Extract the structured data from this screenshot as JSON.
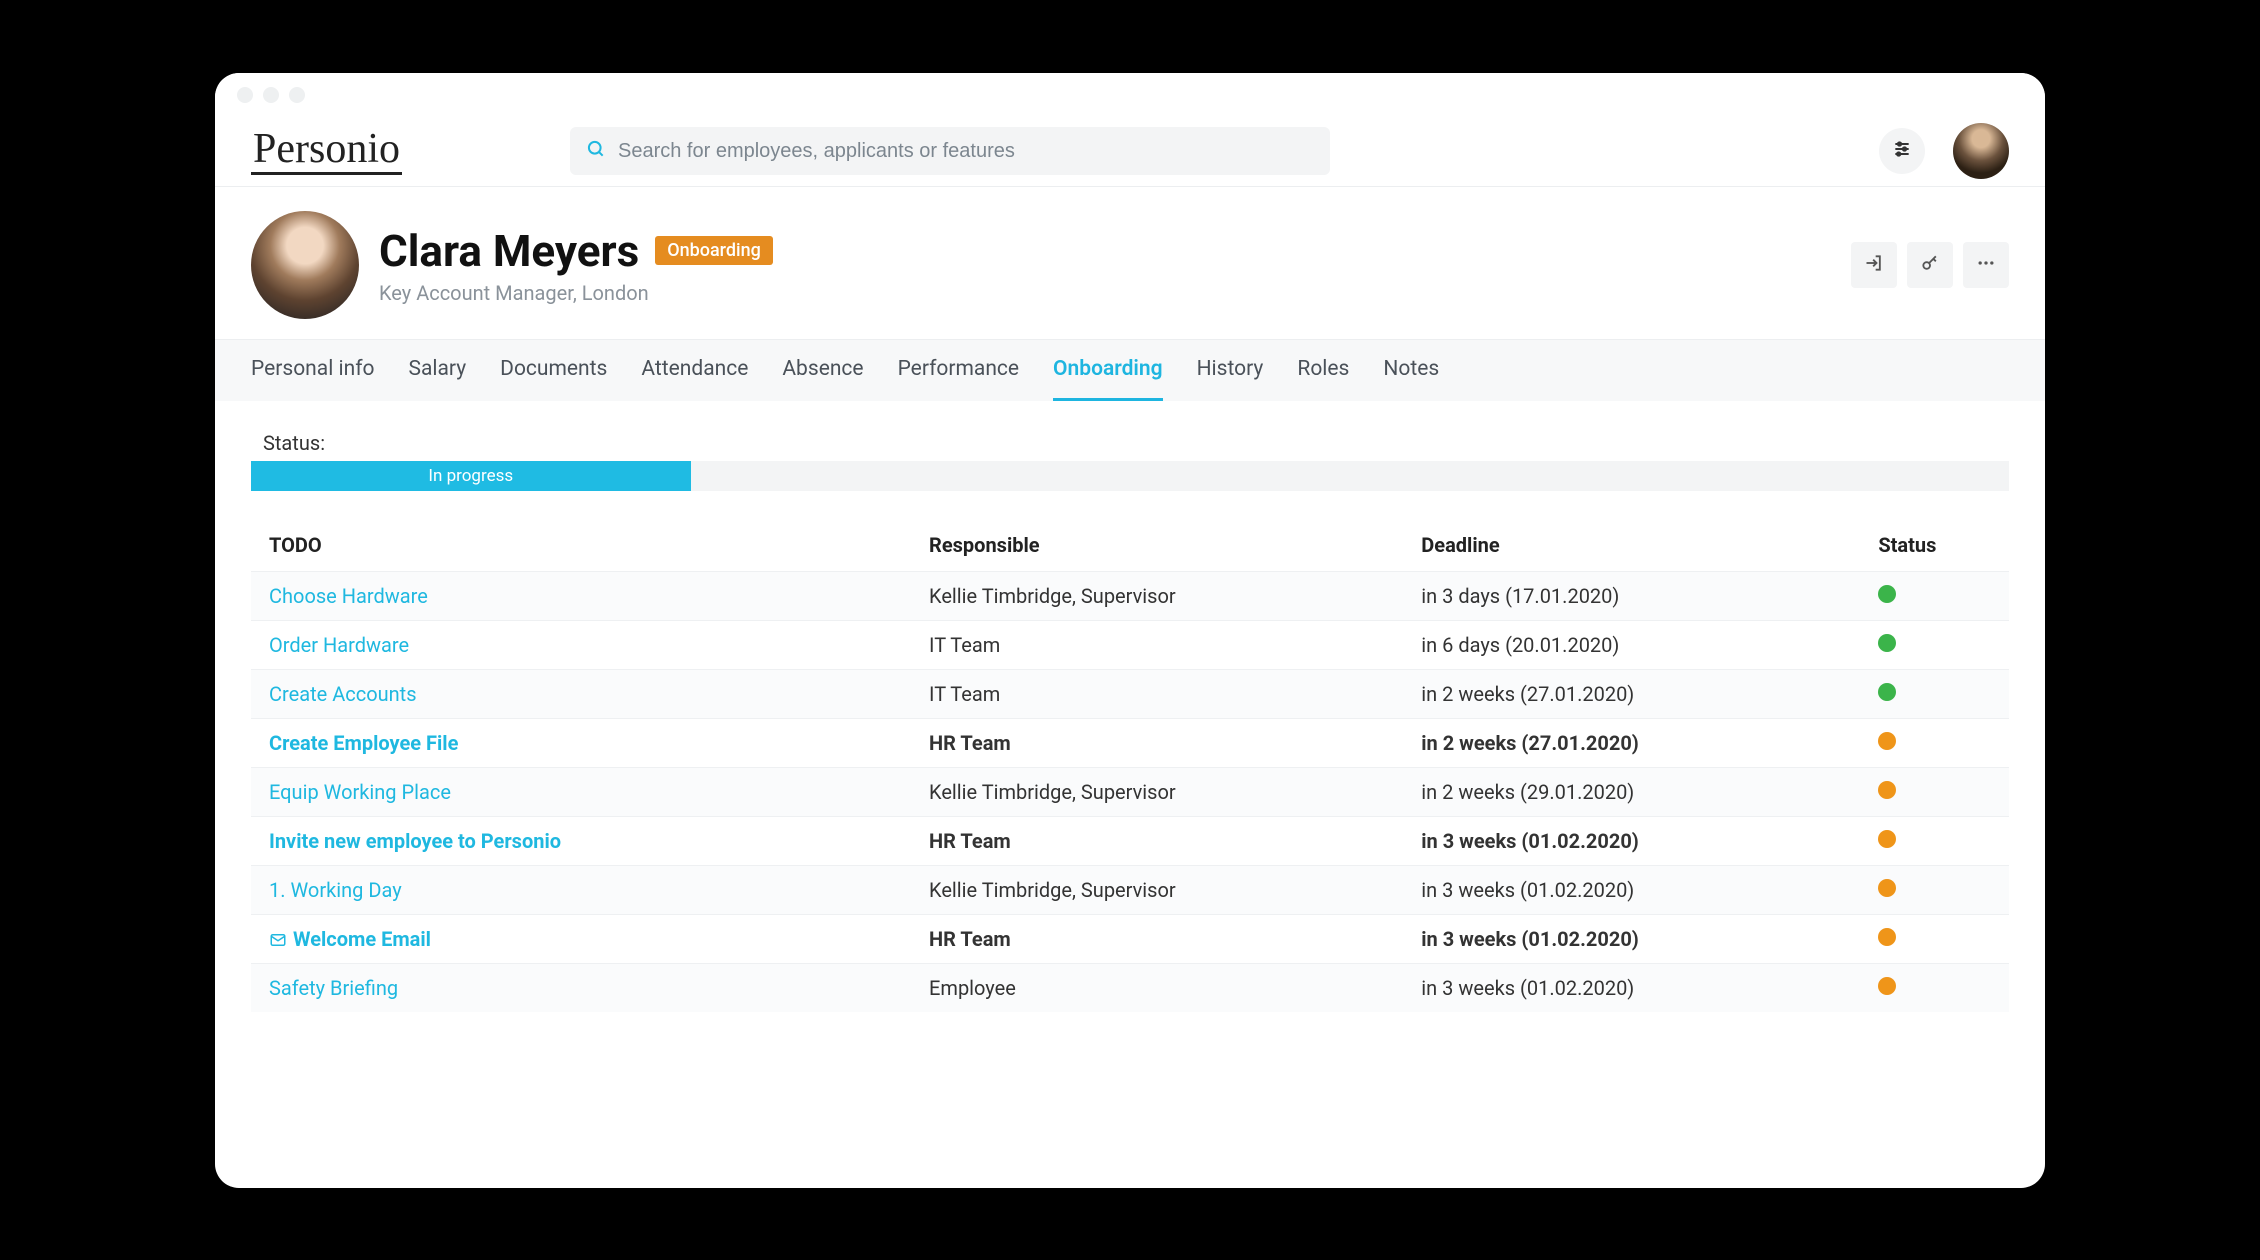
{
  "brand": "Personio",
  "search": {
    "placeholder": "Search for employees, applicants or features"
  },
  "profile": {
    "name": "Clara Meyers",
    "badge": "Onboarding",
    "subtitle": "Key Account Manager, London"
  },
  "tabs": [
    {
      "label": "Personal info",
      "active": false
    },
    {
      "label": "Salary",
      "active": false
    },
    {
      "label": "Documents",
      "active": false
    },
    {
      "label": "Attendance",
      "active": false
    },
    {
      "label": "Absence",
      "active": false
    },
    {
      "label": "Performance",
      "active": false
    },
    {
      "label": "Onboarding",
      "active": true
    },
    {
      "label": "History",
      "active": false
    },
    {
      "label": "Roles",
      "active": false
    },
    {
      "label": "Notes",
      "active": false
    }
  ],
  "status": {
    "label": "Status:",
    "progress_text": "In progress",
    "progress_pct": 25
  },
  "table": {
    "headers": {
      "todo": "TODO",
      "responsible": "Responsible",
      "deadline": "Deadline",
      "status": "Status"
    },
    "rows": [
      {
        "todo": "Choose Hardware",
        "responsible": "Kellie Timbridge, Supervisor",
        "deadline": "in 3 days (17.01.2020)",
        "status": "green",
        "bold": false,
        "mail": false
      },
      {
        "todo": "Order Hardware",
        "responsible": "IT Team",
        "deadline": "in 6 days (20.01.2020)",
        "status": "green",
        "bold": false,
        "mail": false
      },
      {
        "todo": "Create Accounts",
        "responsible": "IT Team",
        "deadline": "in 2 weeks (27.01.2020)",
        "status": "green",
        "bold": false,
        "mail": false
      },
      {
        "todo": "Create Employee File",
        "responsible": "HR Team",
        "deadline": "in 2 weeks (27.01.2020)",
        "status": "orange",
        "bold": true,
        "mail": false
      },
      {
        "todo": "Equip Working Place",
        "responsible": "Kellie Timbridge, Supervisor",
        "deadline": "in 2 weeks (29.01.2020)",
        "status": "orange",
        "bold": false,
        "mail": false
      },
      {
        "todo": "Invite new employee to Personio",
        "responsible": "HR Team",
        "deadline": "in 3 weeks (01.02.2020)",
        "status": "orange",
        "bold": true,
        "mail": false
      },
      {
        "todo": "1. Working Day",
        "responsible": "Kellie Timbridge, Supervisor",
        "deadline": "in 3 weeks (01.02.2020)",
        "status": "orange",
        "bold": false,
        "mail": false
      },
      {
        "todo": "Welcome Email",
        "responsible": "HR Team",
        "deadline": "in 3 weeks (01.02.2020)",
        "status": "orange",
        "bold": true,
        "mail": true
      },
      {
        "todo": "Safety Briefing",
        "responsible": "Employee",
        "deadline": "in 3 weeks (01.02.2020)",
        "status": "orange",
        "bold": false,
        "mail": false
      }
    ]
  }
}
